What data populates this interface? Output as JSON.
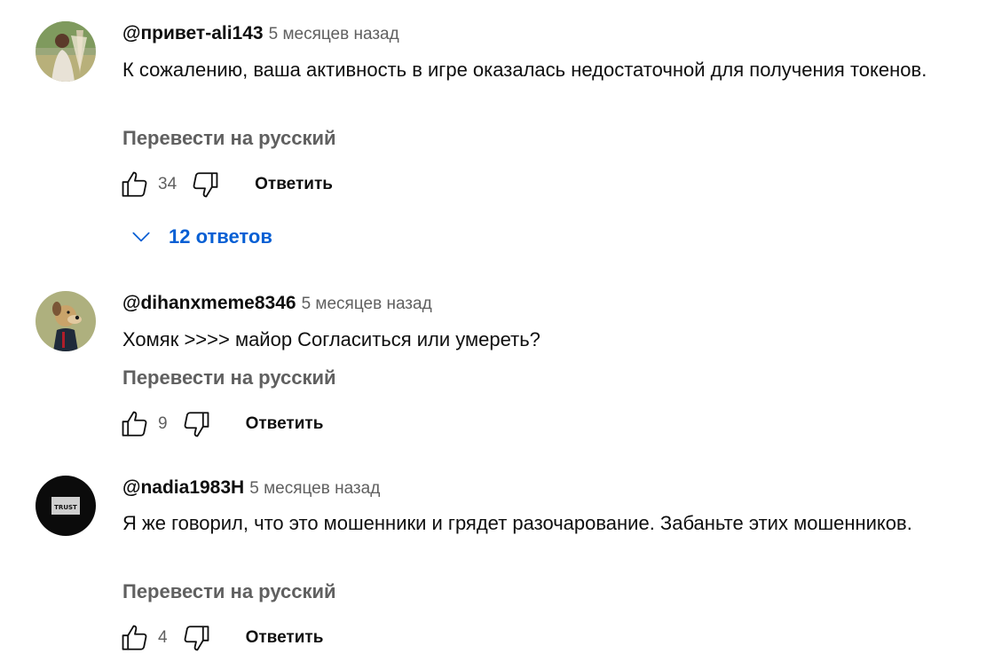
{
  "comments": [
    {
      "author": "@привет-ali143",
      "time": "5 месяцев назад",
      "text": "К сожалению, ваша активность в игре оказалась недостаточной для получения токенов.",
      "translate": "Перевести на русский",
      "likes": "34",
      "reply": "Ответить",
      "replies": "12 ответов"
    },
    {
      "author": "@dihanxmeme8346",
      "time": "5 месяцев назад",
      "text": "Хомяк >>>> майор Согласиться или умереть?",
      "translate": "Перевести на русский",
      "likes": "9",
      "reply": "Ответить"
    },
    {
      "author": "@nadia1983H",
      "time": "5 месяцев назад",
      "text": "Я же говорил, что это мошенники и грядет разочарование. Забаньте этих мошенников.",
      "translate": "Перевести на русский",
      "likes": "4",
      "reply": "Ответить",
      "avatar_text": "TRUST"
    }
  ],
  "icons": {
    "like": "thumbs-up-icon",
    "dislike": "thumbs-down-icon",
    "expand": "chevron-down-icon"
  },
  "colors": {
    "link_blue": "#065fd4",
    "secondary_text": "#606060",
    "primary_text": "#0f0f0f"
  }
}
